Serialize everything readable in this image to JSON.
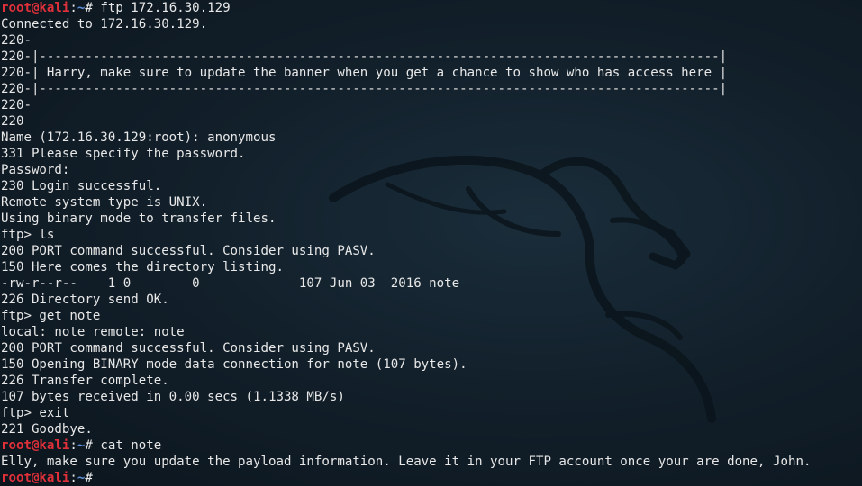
{
  "prompt": {
    "user": "root@kali",
    "sep": ":",
    "path": "~",
    "symbol": "# "
  },
  "lines": [
    {
      "type": "prompt",
      "cmd": "ftp 172.16.30.129"
    },
    {
      "type": "text",
      "text": "Connected to 172.16.30.129."
    },
    {
      "type": "text",
      "text": "220-"
    },
    {
      "type": "text",
      "text": "220-|-----------------------------------------------------------------------------------------|"
    },
    {
      "type": "text",
      "text": "220-| Harry, make sure to update the banner when you get a chance to show who has access here |"
    },
    {
      "type": "text",
      "text": "220-|-----------------------------------------------------------------------------------------|"
    },
    {
      "type": "text",
      "text": "220-"
    },
    {
      "type": "text",
      "text": "220"
    },
    {
      "type": "text",
      "text": "Name (172.16.30.129:root): anonymous"
    },
    {
      "type": "text",
      "text": "331 Please specify the password."
    },
    {
      "type": "text",
      "text": "Password:"
    },
    {
      "type": "text",
      "text": "230 Login successful."
    },
    {
      "type": "text",
      "text": "Remote system type is UNIX."
    },
    {
      "type": "text",
      "text": "Using binary mode to transfer files."
    },
    {
      "type": "text",
      "text": "ftp> ls"
    },
    {
      "type": "text",
      "text": "200 PORT command successful. Consider using PASV."
    },
    {
      "type": "text",
      "text": "150 Here comes the directory listing."
    },
    {
      "type": "text",
      "text": "-rw-r--r--    1 0        0             107 Jun 03  2016 note"
    },
    {
      "type": "text",
      "text": "226 Directory send OK."
    },
    {
      "type": "text",
      "text": "ftp> get note"
    },
    {
      "type": "text",
      "text": "local: note remote: note"
    },
    {
      "type": "text",
      "text": "200 PORT command successful. Consider using PASV."
    },
    {
      "type": "text",
      "text": "150 Opening BINARY mode data connection for note (107 bytes)."
    },
    {
      "type": "text",
      "text": "226 Transfer complete."
    },
    {
      "type": "text",
      "text": "107 bytes received in 0.00 secs (1.1338 MB/s)"
    },
    {
      "type": "text",
      "text": "ftp> exit"
    },
    {
      "type": "text",
      "text": "221 Goodbye."
    },
    {
      "type": "prompt",
      "cmd": "cat note"
    },
    {
      "type": "text",
      "text": "Elly, make sure you update the payload information. Leave it in your FTP account once your are done, John."
    },
    {
      "type": "prompt",
      "cmd": ""
    }
  ],
  "colors": {
    "background": "#12202b",
    "text": "#e8e8e8",
    "prompt_user": "#e0303a",
    "prompt_path": "#5f8fd8"
  },
  "icons": {
    "watermark": "kali-dragon-logo"
  }
}
